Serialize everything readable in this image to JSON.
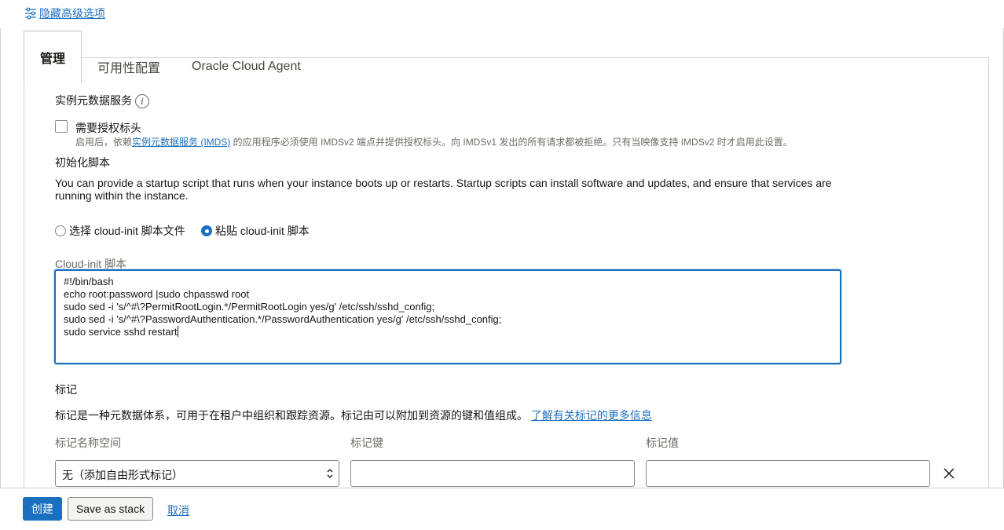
{
  "advanced": {
    "toggle_label": "隐藏高级选项",
    "icon": "sliders-icon"
  },
  "tabs": [
    {
      "label": "管理",
      "active": true
    },
    {
      "label": "可用性配置",
      "active": false
    },
    {
      "label": "Oracle Cloud Agent",
      "active": false
    }
  ],
  "imds": {
    "title": "实例元数据服务",
    "checkbox_label": "需要授权标头",
    "checked": false,
    "helper_prefix": "启用后，依赖",
    "helper_link": "实例元数据服务 (IMDS)",
    "helper_suffix": " 的应用程序必须使用 IMDSv2 端点并提供授权标头。向 IMDSv1 发出的所有请求都被拒绝。只有当映像支持 IMDSv2 时才启用此设置。"
  },
  "init_script": {
    "title": "初始化脚本",
    "description": "You can provide a startup script that runs when your instance boots up or restarts. Startup scripts can install software and updates, and ensure that services are running within the instance.",
    "radio_file": "选择 cloud-init 脚本文件",
    "radio_paste": "粘贴 cloud-init 脚本",
    "selected": "paste",
    "field_label": "Cloud-init 脚本",
    "lines": [
      "#!/bin/bash",
      "echo root:password |sudo chpasswd root",
      "sudo sed -i 's/^#\\?PermitRootLogin.*/PermitRootLogin yes/g' /etc/ssh/sshd_config;",
      "sudo sed -i 's/^#\\?PasswordAuthentication.*/PasswordAuthentication yes/g' /etc/ssh/sshd_config;",
      "sudo service sshd restart"
    ]
  },
  "tags": {
    "title": "标记",
    "description": "标记是一种元数据体系，可用于在租户中组织和跟踪资源。标记由可以附加到资源的键和值组成。",
    "learn_more": "了解有关标记的更多信息",
    "namespace_label": "标记名称空间",
    "key_label": "标记键",
    "value_label": "标记值",
    "namespace_value": "无（添加自由形式标记）",
    "key_value": "",
    "value_value": ""
  },
  "footer": {
    "create_label": "创建",
    "save_stack_label": "Save as stack",
    "cancel_label": "取消"
  },
  "colors": {
    "accent": "#1a6fbf",
    "border": "#d4d2cf",
    "text": "#161513",
    "muted": "#6f6c67"
  }
}
